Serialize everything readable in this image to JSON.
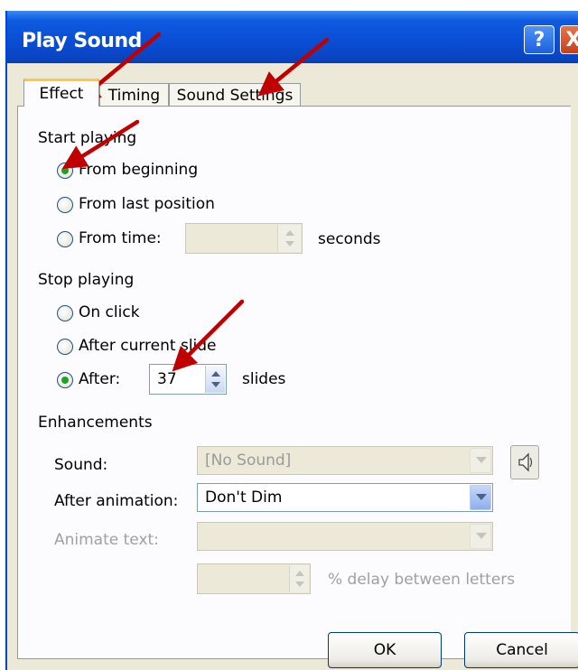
{
  "window": {
    "title": "Play Sound",
    "help_glyph": "?",
    "close_glyph": "X"
  },
  "tabs": [
    {
      "label": "Effect",
      "active": true
    },
    {
      "label": "Timing",
      "active": false
    },
    {
      "label": "Sound Settings",
      "active": false
    }
  ],
  "start_playing": {
    "heading": "Start playing",
    "options": [
      {
        "label": "From beginning",
        "selected": true
      },
      {
        "label": "From last position",
        "selected": false
      },
      {
        "label": "From time:",
        "selected": false
      }
    ],
    "time_value": "",
    "seconds_label": "seconds"
  },
  "stop_playing": {
    "heading": "Stop playing",
    "options": [
      {
        "label": "On click",
        "selected": false
      },
      {
        "label": "After current slide",
        "selected": false
      },
      {
        "label": "After:",
        "selected": true
      }
    ],
    "after_value": "37",
    "slides_label": "slides"
  },
  "enhancements": {
    "heading": "Enhancements",
    "sound_label": "Sound:",
    "sound_value": "[No Sound]",
    "after_animation_label": "After animation:",
    "after_animation_value": "Don't Dim",
    "animate_text_label": "Animate text:",
    "animate_text_value": "",
    "delay_value": "",
    "delay_label": "% delay between letters"
  },
  "buttons": {
    "ok": "OK",
    "cancel": "Cancel"
  },
  "colors": {
    "title_bar": "#0a4fd6",
    "dialog_bg": "#ece9d8",
    "annotation_arrow": "#c00000",
    "active_tab_accent": "#ffc73c"
  },
  "icons": {
    "speaker": "speaker-icon"
  }
}
